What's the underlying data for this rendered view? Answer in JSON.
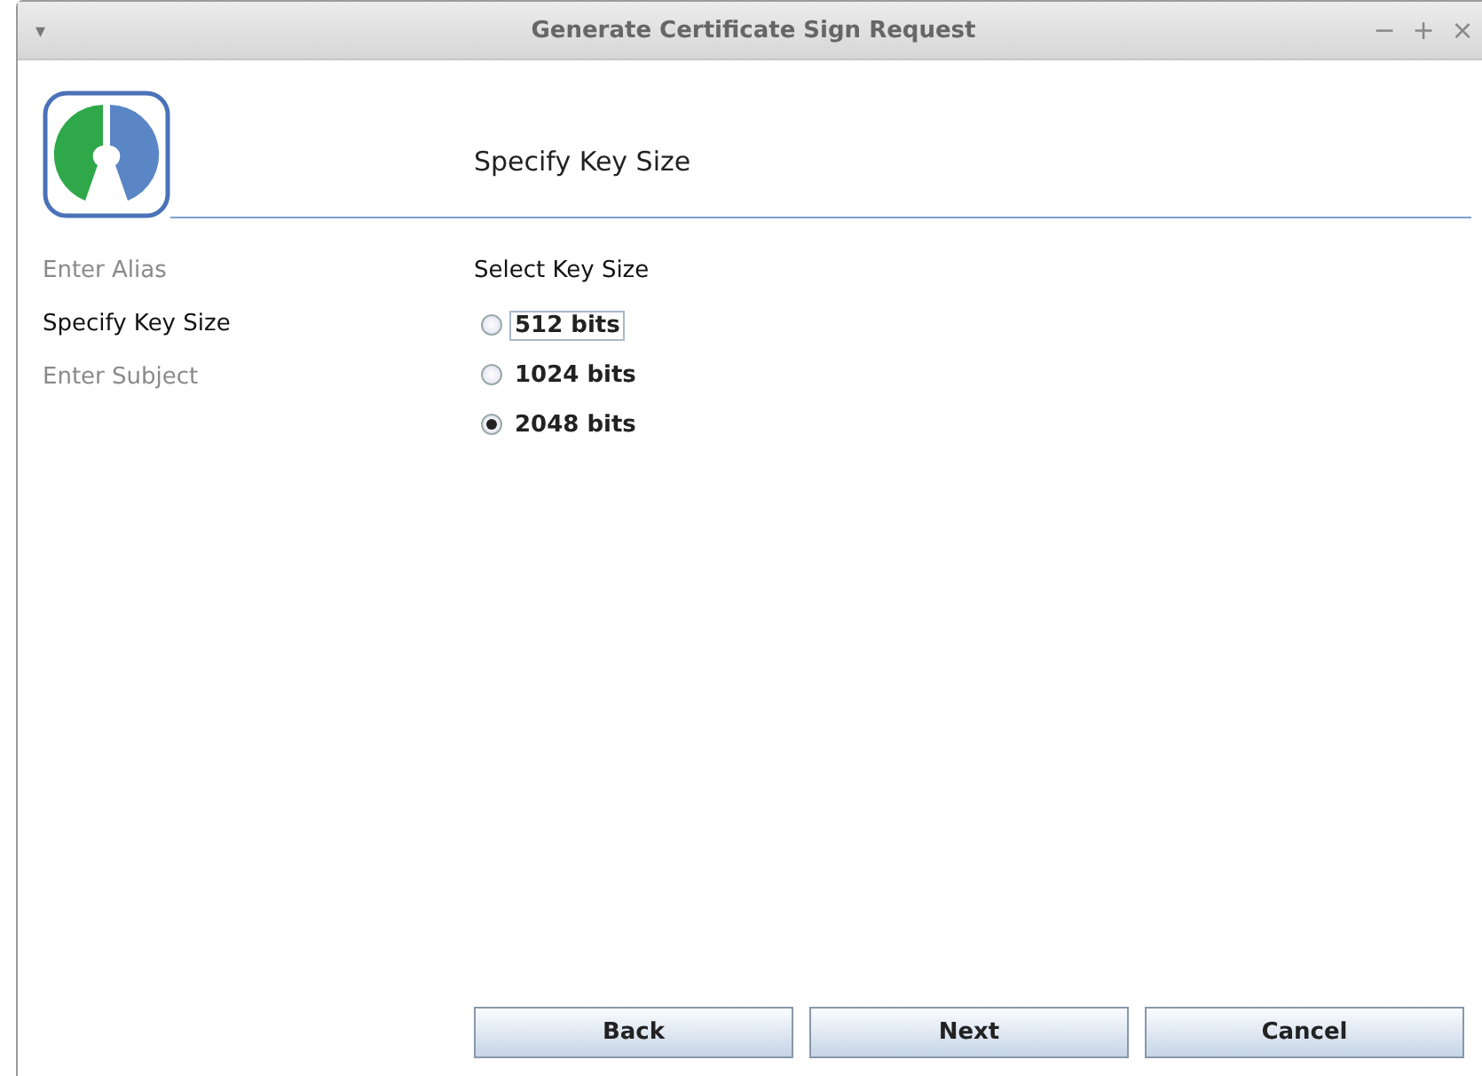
{
  "window": {
    "title": "Generate Certificate Sign Request",
    "menu_glyph": "▾",
    "controls": [
      "−",
      "+",
      "×"
    ]
  },
  "header": {
    "title": "Specify Key Size"
  },
  "steps": [
    {
      "label": "Enter Alias",
      "selected": false
    },
    {
      "label": "Specify Key Size",
      "selected": true
    },
    {
      "label": "Enter Subject",
      "selected": false
    }
  ],
  "key_size": {
    "label": "Select Key Size",
    "options": [
      {
        "label": "512 bits",
        "selected": false,
        "focused": true
      },
      {
        "label": "1024 bits",
        "selected": false,
        "focused": false
      },
      {
        "label": "2048 bits",
        "selected": true,
        "focused": false
      }
    ]
  },
  "buttons": [
    "Back",
    "Next",
    "Cancel"
  ]
}
